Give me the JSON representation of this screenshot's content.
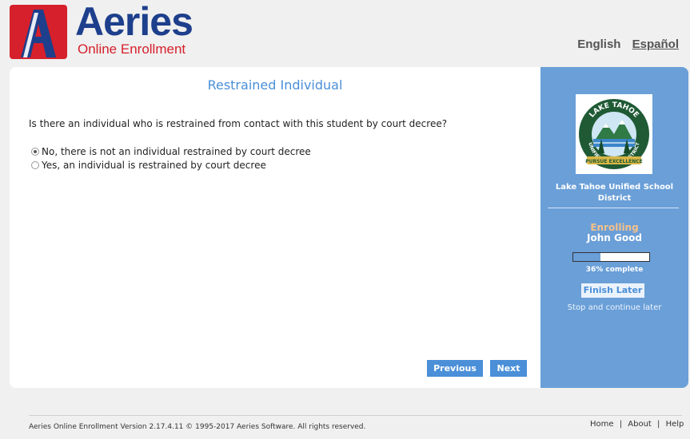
{
  "brand": {
    "logo_letter": "A",
    "title": "Aeries",
    "subtitle": "Online Enrollment",
    "logo_color": "#d6202b",
    "title_color": "#1d3f8c"
  },
  "languages": {
    "english": "English",
    "spanish": "Español"
  },
  "page": {
    "title": "Restrained Individual",
    "question": "Is there an individual who is restrained from contact with this student by court decree?",
    "options": [
      {
        "label": "No, there is not an individual restrained by court decree",
        "selected": true
      },
      {
        "label": "Yes, an individual is restrained by court decree",
        "selected": false
      }
    ],
    "previous_label": "Previous",
    "next_label": "Next",
    "accent_color": "#4a8fd8"
  },
  "sidebar": {
    "district_logo_text": {
      "top": "LAKE TAHOE",
      "bottom": "UNIFIED SCHOOL DISTRICT",
      "banner": "PURSUE EXCELLENCE"
    },
    "district_name": "Lake Tahoe Unified School District",
    "enrolling_label": "Enrolling",
    "student_name": "John Good",
    "progress_percent": 36,
    "progress_text": "36% complete",
    "finish_later_label": "Finish Later",
    "stop_text": "Stop and continue later",
    "background_color": "#6a9fd8"
  },
  "footer": {
    "copyright": "Aeries Online Enrollment Version 2.17.4.11 © 1995-2017 Aeries Software. All rights reserved.",
    "home": "Home",
    "about": "About",
    "help": "Help",
    "separator": "|"
  }
}
